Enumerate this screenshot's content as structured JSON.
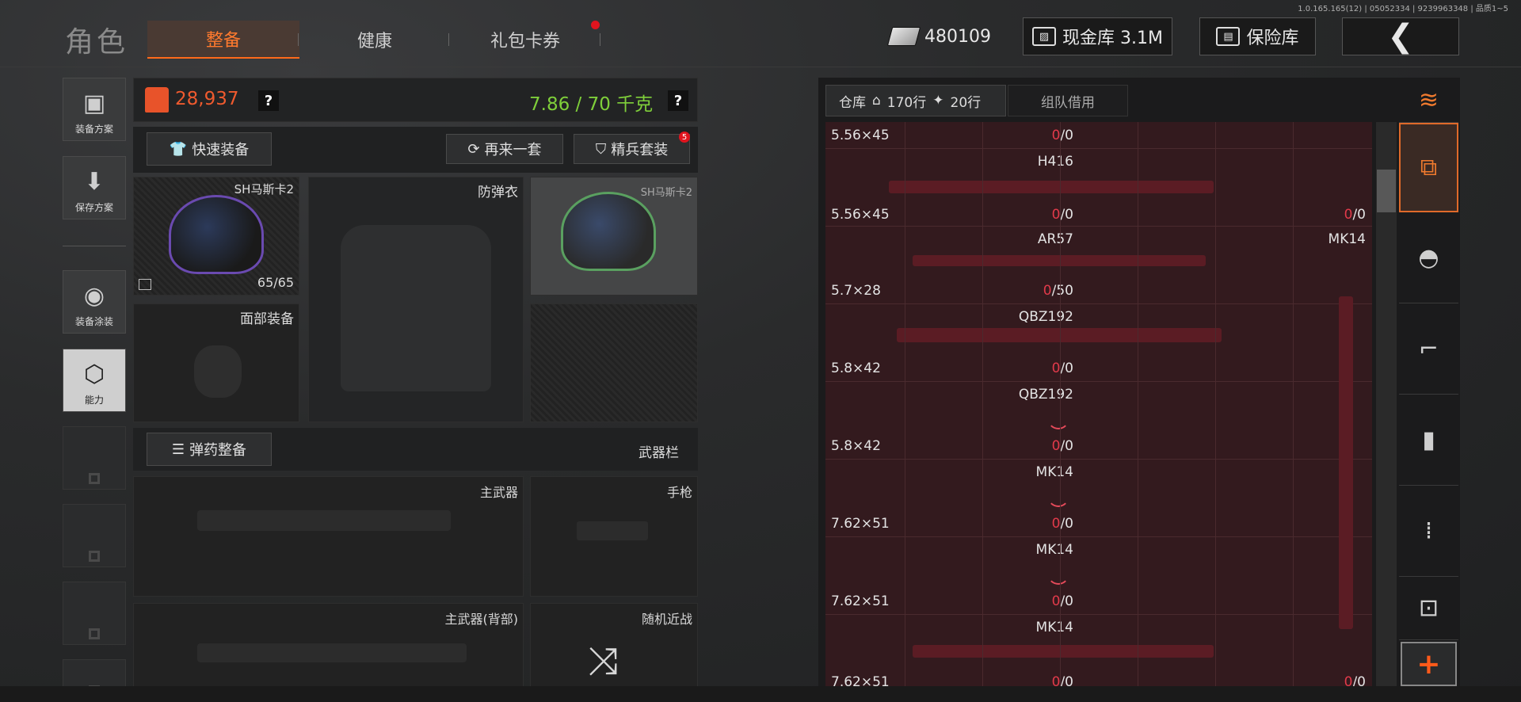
{
  "header": {
    "title": "角色",
    "tabs": [
      {
        "label": "整备",
        "active": true
      },
      {
        "label": "健康",
        "active": false
      },
      {
        "label": "礼包卡券",
        "active": false
      }
    ],
    "version": "1.0.165.165(12) | 05052334 | 9239963348 | 品质1~5",
    "money_value": "480109",
    "cash_vault_label": "现金库 3.1M",
    "safe_label": "保险库",
    "back_icon": "chevron-left-icon"
  },
  "sidebar": {
    "items": [
      {
        "label": "装备方案",
        "icon": "vest-icon"
      },
      {
        "label": "保存方案",
        "icon": "download-icon"
      },
      {
        "label": "装备涂装",
        "icon": "helmet-icon"
      },
      {
        "label": "能力",
        "icon": "lightning-hex-icon"
      }
    ]
  },
  "loadout": {
    "value": "28,937",
    "weight": "7.86 / 70 千克",
    "help": "?",
    "quick_equip": "快速装备",
    "again": "再来一套",
    "elite": "精兵套装",
    "elite_badge": "5",
    "slots": {
      "helmet_name": "SH马斯卡2",
      "helmet_durability": "65/65",
      "armor": "防弹衣",
      "face": "面部装备",
      "helmet_skin_name": "SH马斯卡2"
    },
    "ammo_button": "弹药整备",
    "weapon_bar": "武器栏",
    "primary": "主武器",
    "pistol": "手枪",
    "primary_back": "主武器(背部)",
    "melee": "随机近战"
  },
  "warehouse": {
    "tabs": [
      {
        "label": "仓库"
      },
      {
        "label": "170行"
      },
      {
        "label": "20行"
      },
      {
        "label": "组队借用"
      }
    ],
    "rows": [
      {
        "name": "",
        "ammo": "5.56×45",
        "count_a": "0",
        "count_b": "0"
      },
      {
        "name": "H416",
        "ammo": "5.56×45",
        "count_a": "0",
        "count_b": "0",
        "extra_a": "0",
        "extra_b": "0"
      },
      {
        "name": "AR57",
        "ammo": "5.7×28",
        "count_a": "0",
        "count_b": "50",
        "side_name": "MK14"
      },
      {
        "name": "QBZ192",
        "ammo": "5.8×42",
        "count_a": "0",
        "count_b": "0"
      },
      {
        "name": "QBZ192",
        "ammo": "5.8×42",
        "count_a": "0",
        "count_b": "0"
      },
      {
        "name": "MK14",
        "ammo": "7.62×51",
        "count_a": "0",
        "count_b": "0"
      },
      {
        "name": "MK14",
        "ammo": "7.62×51",
        "count_a": "0",
        "count_b": "0"
      },
      {
        "name": "MK14",
        "ammo": "7.62×51",
        "count_a": "0",
        "count_b": "0",
        "extra_a": "0",
        "extra_b": "0"
      }
    ]
  },
  "right_nav": [
    {
      "icon": "layers-refresh-icon"
    },
    {
      "icon": "layers-import-icon"
    },
    {
      "icon": "helmet-icon"
    },
    {
      "icon": "rifle-icon"
    },
    {
      "icon": "magazine-icon"
    },
    {
      "icon": "bullets-icon"
    },
    {
      "icon": "scope-icon"
    },
    {
      "icon": "plus-icon",
      "label": "+"
    }
  ]
}
